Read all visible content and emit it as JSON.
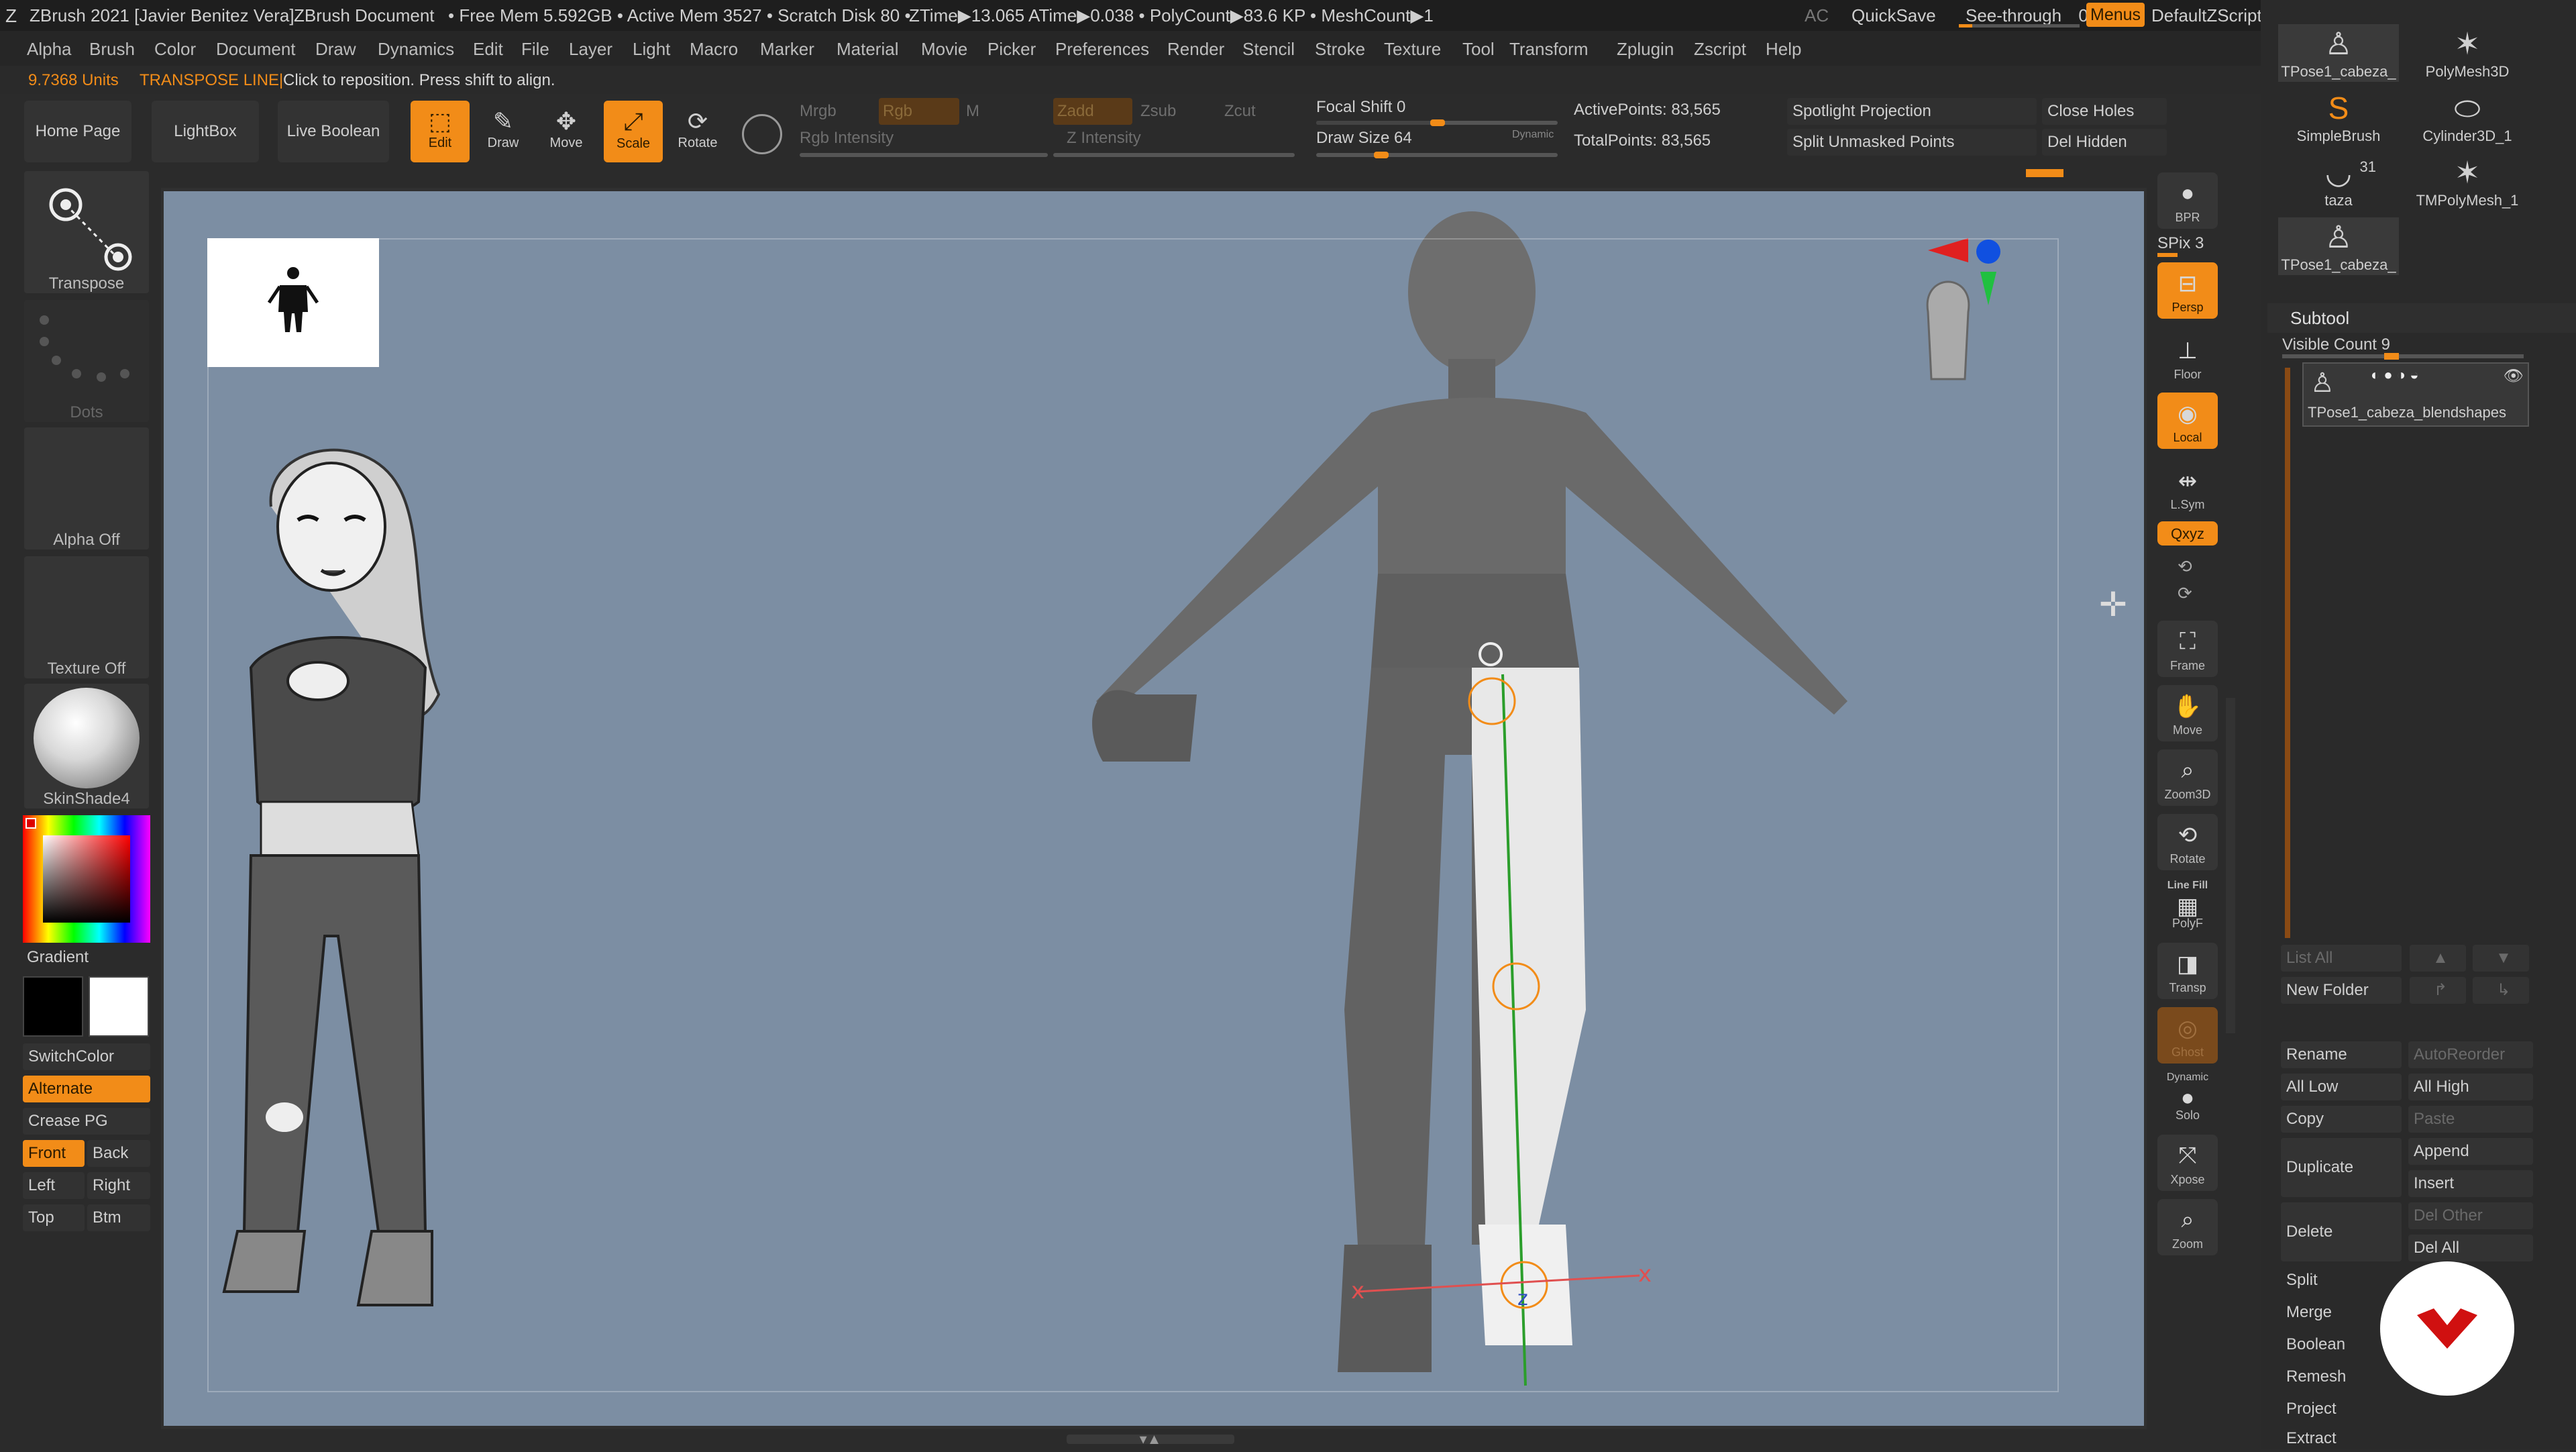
{
  "titlebar": {
    "app": "ZBrush 2021 [Javier Benitez Vera]",
    "doc": "ZBrush Document",
    "stats": "• Free Mem 5.592GB • Active Mem 3527 • Scratch Disk 80 •",
    "ztime": "ZTime▶13.065 ATime▶0.038 • PolyCount▶83.6 KP • MeshCount▶1",
    "ac": "AC",
    "quicksave": "QuickSave",
    "seethrough": "See-through",
    "seethrough_value": "0",
    "menus": "Menus",
    "script": "DefaultZScript"
  },
  "menus": [
    "Alpha",
    "Brush",
    "Color",
    "Document",
    "Draw",
    "Dynamics",
    "Edit",
    "File",
    "Layer",
    "Light",
    "Macro",
    "Marker",
    "Material",
    "Movie",
    "Picker",
    "Preferences",
    "Render",
    "Stencil",
    "Stroke",
    "Texture",
    "Tool",
    "Transform",
    "Zplugin",
    "Zscript",
    "Help"
  ],
  "status": {
    "units": "9.7368 Units",
    "mode": "TRANSPOSE LINE|",
    "hint": "Click to reposition. Press shift to align."
  },
  "toolbar": {
    "home": "Home Page",
    "lightbox": "LightBox",
    "liveboolean": "Live Boolean",
    "edit": "Edit",
    "draw": "Draw",
    "move": "Move",
    "scale": "Scale",
    "rotate": "Rotate",
    "mrgb": "Mrgb",
    "rgb": "Rgb",
    "m": "M",
    "rgb_intensity": "Rgb Intensity",
    "zadd": "Zadd",
    "zsub": "Zsub",
    "zcut": "Zcut",
    "z_intensity": "Z Intensity",
    "focal_shift": "Focal Shift 0",
    "draw_size": "Draw Size 64",
    "dynamic": "Dynamic",
    "active_points": "ActivePoints: 83,565",
    "total_points": "TotalPoints: 83,565",
    "spotlight": "Spotlight Projection",
    "split_unmasked": "Split Unmasked Points",
    "close_holes": "Close Holes",
    "del_hidden": "Del Hidden"
  },
  "lefttray": {
    "transpose": "Transpose",
    "dots": "Dots",
    "alpha": "Alpha Off",
    "texture": "Texture Off",
    "material": "SkinShade4",
    "gradient": "Gradient",
    "switchcolor": "SwitchColor",
    "alternate": "Alternate",
    "creasepg": "Crease PG",
    "front": "Front",
    "back": "Back",
    "left": "Left",
    "right": "Right",
    "top": "Top",
    "btm": "Btm"
  },
  "shelf": {
    "bpr": "BPR",
    "spix": "SPix 3",
    "persp": "Persp",
    "floor": "Floor",
    "local": "Local",
    "lsym": "L.Sym",
    "xyz": "Qxyz",
    "frame": "Frame",
    "move": "Move",
    "zoom3d": "Zoom3D",
    "rotate": "Rotate",
    "linefill": "Line Fill",
    "polyf": "PolyF",
    "transp": "Transp",
    "ghost": "Ghost",
    "dynamic": "Dynamic",
    "solo": "Solo",
    "xpose": "Xpose",
    "zoom": "Zoom"
  },
  "tools": {
    "tpose_a": "TPose1_cabeza_",
    "polymesh": "PolyMesh3D",
    "simplebrush": "SimpleBrush",
    "cylinder": "Cylinder3D_1",
    "taza": "taza",
    "taza_count": "31",
    "tmpoly": "TMPolyMesh_1",
    "tpose_b": "TPose1_cabeza_"
  },
  "subtool": {
    "header": "Subtool",
    "visible": "Visible Count 9",
    "item": "TPose1_cabeza_blendshapes",
    "listall": "List All",
    "newfolder": "New Folder",
    "rename": "Rename",
    "autoreorder": "AutoReorder",
    "alllow": "All Low",
    "allhigh": "All High",
    "copy": "Copy",
    "paste": "Paste",
    "duplicate": "Duplicate",
    "append": "Append",
    "insert": "Insert",
    "delete": "Delete",
    "delother": "Del Other",
    "delall": "Del All",
    "split": "Split",
    "merge": "Merge",
    "boolean": "Boolean",
    "remesh": "Remesh",
    "project": "Project",
    "extract": "Extract"
  },
  "colors": {
    "accent": "#f28c18",
    "canvas": "#7c8ea3",
    "panel": "#2b2b2b"
  }
}
